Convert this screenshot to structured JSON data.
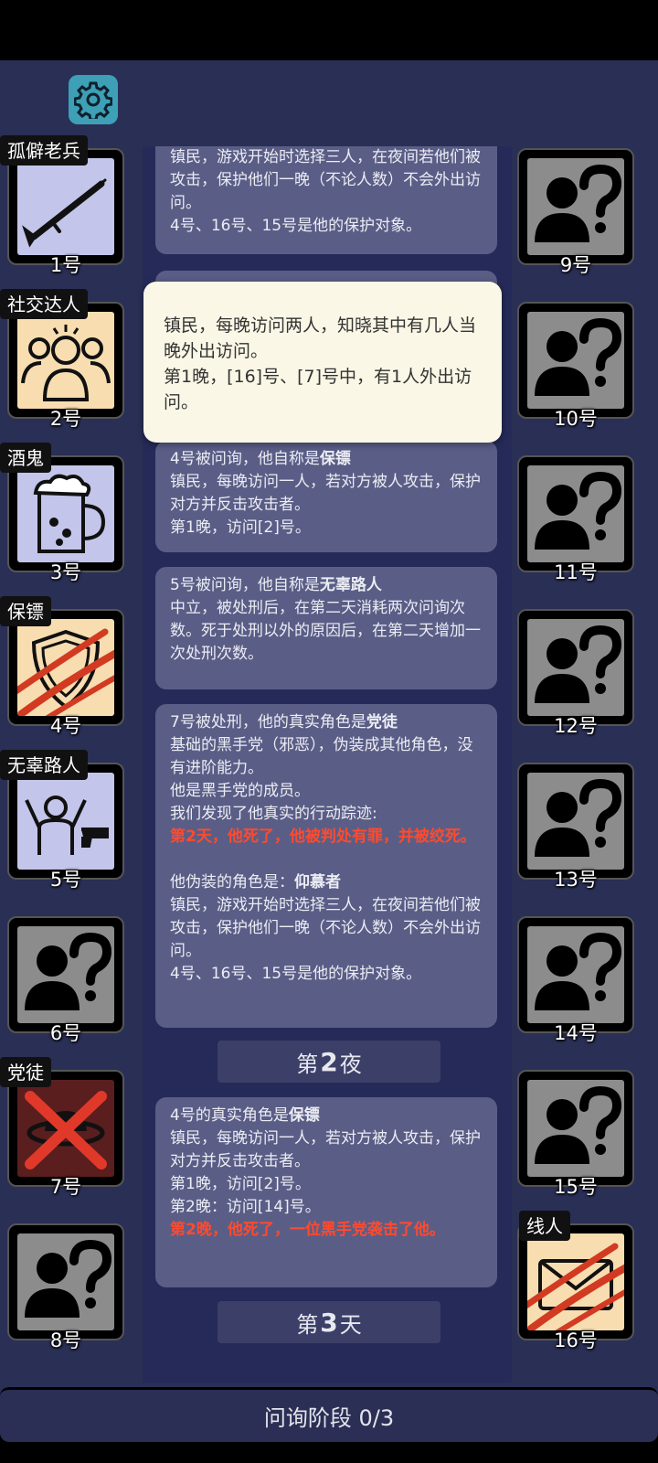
{
  "phase_bar": {
    "label": "问询阶段 0/3"
  },
  "log": {
    "card0_text": "镇民，游戏开始时选择三人，在夜间若他们被攻击，保护他们一晚（不论人数）不会外出访问。\n4号、16号、15号是他的保护对象。",
    "card1_head": "4号被问询，他自称是",
    "card1_role": "保镖",
    "card1_body": "镇民，每晚访问一人，若对方被人攻击，保护对方并反击攻击者。\n第1晚，访问[2]号。",
    "card2_head": "5号被问询，他自称是",
    "card2_role": "无辜路人",
    "card2_body": "中立，被处刑后，在第二天消耗两次问询次数。死于处刑以外的原因后，在第二天增加一次处刑次数。",
    "card3_head": "7号被处刑，他的真实角色是",
    "card3_role": "党徒",
    "card3_body": "基础的黑手党（邪恶），伪装成其他角色，没有进阶能力。\n他是黑手党的成员。\n我们发现了他真实的行动踪迹:",
    "card3_red": "第2天，他死了，他被判处有罪，并被绞死。",
    "card3_fake_head": "他伪装的角色是：",
    "card3_fake_role": "仰慕者",
    "card3_fake_body": "镇民，游戏开始时选择三人，在夜间若他们被攻击，保护他们一晚（不论人数）不会外出访问。\n4号、16号、15号是他的保护对象。",
    "banner_night_pre": "第",
    "banner_night_num": "2",
    "banner_night_post": "夜",
    "card4_head": "4号的真实角色是",
    "card4_role": "保镖",
    "card4_body": "镇民，每晚访问一人，若对方被人攻击，保护对方并反击攻击者。\n第1晚，访问[2]号。\n第2晚：访问[14]号。",
    "card4_red": "第2晚，他死了，一位黑手党袭击了他。",
    "banner_day_pre": "第",
    "banner_day_num": "3",
    "banner_day_post": "天"
  },
  "popup": {
    "text": "镇民，每晚访问两人，知晓其中有几人当晚外出访问。\n第1晚，[16]号、[7]号中，有1人外出访问。"
  },
  "players_left": [
    {
      "num": "1号",
      "tag": "孤僻老兵",
      "icon": "rifle-icon"
    },
    {
      "num": "2号",
      "tag": "社交达人",
      "icon": "crowd-icon"
    },
    {
      "num": "3号",
      "tag": "酒鬼",
      "icon": "beer-mug-icon"
    },
    {
      "num": "4号",
      "tag": "保镖",
      "icon": "shield-icon"
    },
    {
      "num": "5号",
      "tag": "无辜路人",
      "icon": "hostage-icon"
    },
    {
      "num": "6号",
      "tag": "",
      "icon": "unknown-person-icon"
    },
    {
      "num": "7号",
      "tag": "党徒",
      "icon": "mafia-hat-icon"
    },
    {
      "num": "8号",
      "tag": "",
      "icon": "unknown-person-icon"
    }
  ],
  "players_right": [
    {
      "num": "9号",
      "icon": "unknown-person-icon"
    },
    {
      "num": "10号",
      "icon": "unknown-person-icon"
    },
    {
      "num": "11号",
      "icon": "unknown-person-icon"
    },
    {
      "num": "12号",
      "icon": "unknown-person-icon"
    },
    {
      "num": "13号",
      "icon": "unknown-person-icon"
    },
    {
      "num": "14号",
      "icon": "unknown-person-icon"
    },
    {
      "num": "15号",
      "icon": "unknown-person-icon"
    },
    {
      "num": "16号",
      "tag": "线人",
      "icon": "envelope-icon"
    }
  ],
  "colors": {
    "background": "#2a2f55",
    "log_card": "#5a5e86",
    "alert_red": "#ff4a2e",
    "settings_teal": "#3da0b6"
  }
}
